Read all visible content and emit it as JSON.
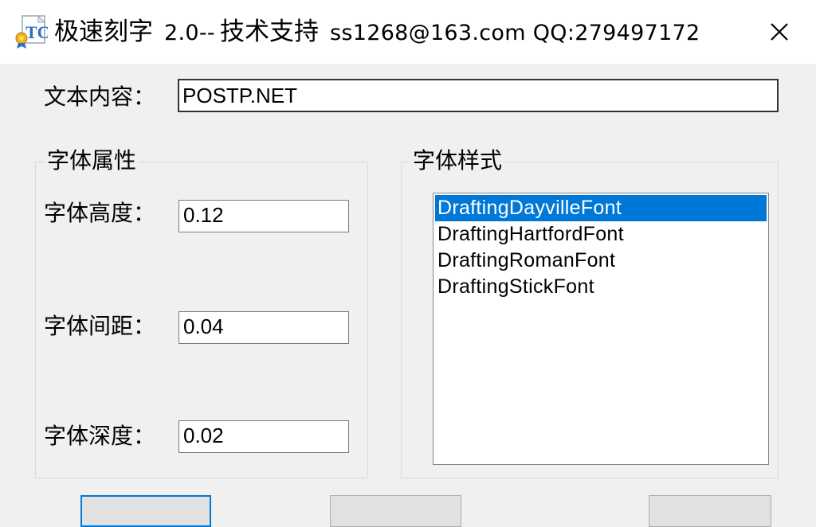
{
  "window": {
    "title_cn": "极速刻字",
    "title_version": "2.0--",
    "title_cn2": "技术支持",
    "title_contact": "ss1268@163.com QQ:279497172",
    "close_glyph": "✕"
  },
  "text_content": {
    "label": "文本内容：",
    "value": "POSTP.NET"
  },
  "font_properties": {
    "group_title": "字体属性",
    "height_label": "字体高度：",
    "height_value": "0.12",
    "spacing_label": "字体间距：",
    "spacing_value": "0.04",
    "depth_label": "字体深度：",
    "depth_value": "0.02"
  },
  "font_style": {
    "group_title": "字体样式",
    "items": [
      "DraftingDayvilleFont",
      "DraftingHartfordFont",
      "DraftingRomanFont",
      "DraftingStickFont"
    ],
    "selected_index": 0,
    "selection_color": "#0078d7"
  },
  "icons": {
    "app": "tc-app-icon",
    "close": "close-icon"
  }
}
